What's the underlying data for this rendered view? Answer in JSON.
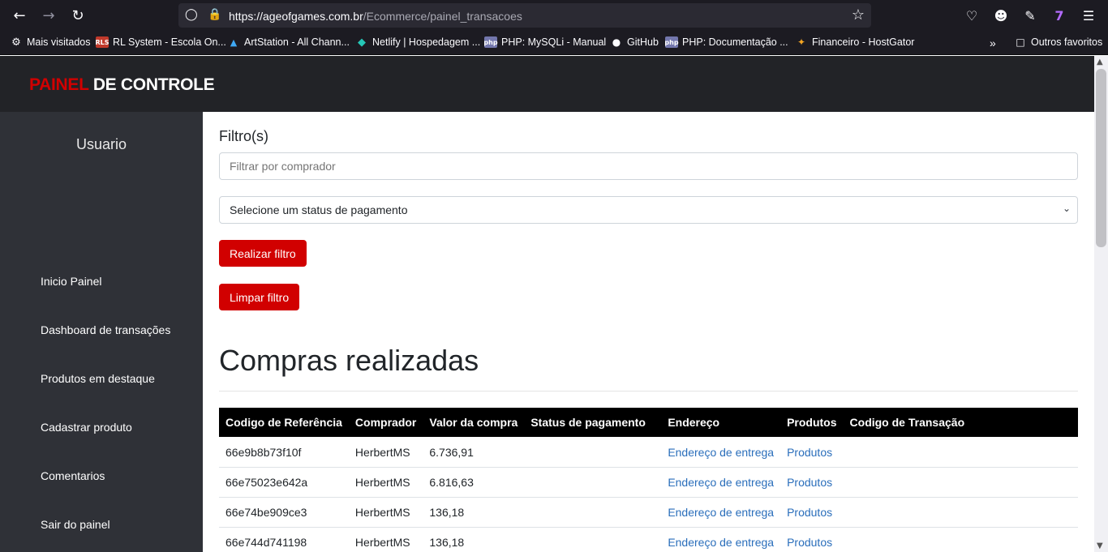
{
  "browser": {
    "url_host": "https://ageofgames.com.br",
    "url_path": "/Ecommerce/painel_transacoes",
    "bookmarks": [
      {
        "label": "Mais visitados",
        "icon": "gear-icon"
      },
      {
        "label": "RL System - Escola On...",
        "icon": "rls-icon",
        "badge": "RLS"
      },
      {
        "label": "ArtStation - All Chann...",
        "icon": "artstation-icon"
      },
      {
        "label": "Netlify | Hospedagem ...",
        "icon": "netlify-icon"
      },
      {
        "label": "PHP: MySQLi - Manual",
        "icon": "php-icon",
        "badge": "php"
      },
      {
        "label": "GitHub",
        "icon": "github-icon"
      },
      {
        "label": "PHP: Documentação ...",
        "icon": "php-icon",
        "badge": "php"
      },
      {
        "label": "Financeiro - HostGator",
        "icon": "hostgator-icon"
      }
    ],
    "other_bookmarks": "Outros favoritos"
  },
  "brand": {
    "part1": "PAINEL",
    "part2": " DE CONTROLE",
    "accent_color": "#d10000"
  },
  "sidebar": {
    "user": "Usuario",
    "items": [
      {
        "label": "Inicio Painel"
      },
      {
        "label": "Dashboard de transações"
      },
      {
        "label": "Produtos em destaque"
      },
      {
        "label": "Cadastrar produto"
      },
      {
        "label": "Comentarios"
      },
      {
        "label": "Sair do painel"
      }
    ]
  },
  "filters": {
    "title": "Filtro(s)",
    "buyer_placeholder": "Filtrar por comprador",
    "status_select": "Selecione um status de pagamento",
    "apply_button": "Realizar filtro",
    "clear_button": "Limpar filtro"
  },
  "purchases": {
    "heading": "Compras realizadas",
    "columns": [
      "Codigo de Referência",
      "Comprador",
      "Valor da compra",
      "Status de pagamento",
      "Endereço",
      "Produtos",
      "Codigo de Transação"
    ],
    "rows": [
      {
        "ref": "66e9b8b73f10f",
        "buyer": "HerbertMS",
        "value": "6.736,91",
        "status": "",
        "address": "Endereço de entrega",
        "products": "Produtos",
        "transaction": ""
      },
      {
        "ref": "66e75023e642a",
        "buyer": "HerbertMS",
        "value": "6.816,63",
        "status": "",
        "address": "Endereço de entrega",
        "products": "Produtos",
        "transaction": ""
      },
      {
        "ref": "66e74be909ce3",
        "buyer": "HerbertMS",
        "value": "136,18",
        "status": "",
        "address": "Endereço de entrega",
        "products": "Produtos",
        "transaction": ""
      },
      {
        "ref": "66e744d741198",
        "buyer": "HerbertMS",
        "value": "136,18",
        "status": "",
        "address": "Endereço de entrega",
        "products": "Produtos",
        "transaction": ""
      }
    ]
  }
}
